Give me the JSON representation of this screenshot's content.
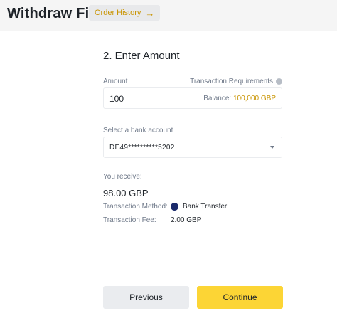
{
  "header": {
    "title": "Withdraw Fiat",
    "order_history": "Order History"
  },
  "form": {
    "step_title": "2. Enter Amount",
    "amount_label": "Amount",
    "requirements_label": "Transaction Requirements",
    "amount_value": "100",
    "balance_prefix": "Balance:",
    "balance_value": "100,000 GBP",
    "bank_label": "Select a bank account",
    "bank_value": "DE49**********5202"
  },
  "summary": {
    "receive_label": "You receive:",
    "receive_amount": "98.00 GBP",
    "method_label": "Transaction Method:",
    "method_value": "Bank Transfer",
    "fee_label": "Transaction Fee:",
    "fee_value": "2.00 GBP"
  },
  "actions": {
    "previous": "Previous",
    "continue": "Continue"
  },
  "colors": {
    "accent": "#fcd535",
    "accent_text": "#c99400",
    "method_dot": "#1a2a6b"
  },
  "icons": {
    "order_history": "arrow-right-icon",
    "requirements": "info-icon",
    "bank_select": "chevron-down-icon",
    "method": "bank-transfer-icon"
  }
}
